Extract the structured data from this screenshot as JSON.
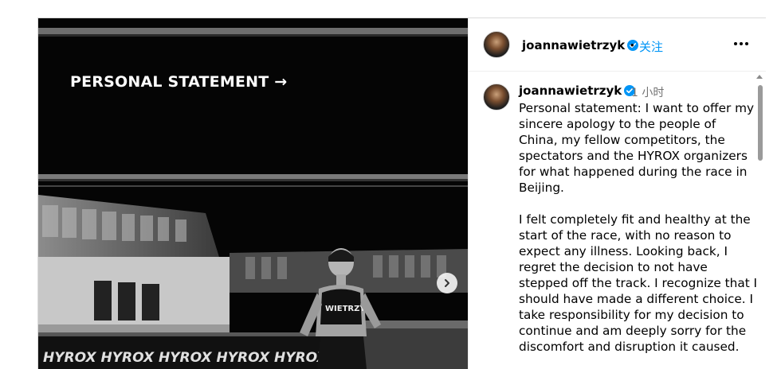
{
  "media": {
    "overlay_text": "PERSONAL STATEMENT →",
    "bib_text": "WIETRZYK",
    "banner_text": "HYROX HYROX HYROX HYROX HYROX HYROX HYROX HYROX"
  },
  "header": {
    "username": "joannawietrzyk",
    "separator": "•",
    "follow_label": "关注",
    "more_icon": "more-options-icon"
  },
  "comment": {
    "username": "joannawietrzyk",
    "time": "1 小时",
    "paragraphs": [
      "Personal statement: I want to offer my sincere apology to the people of China, my fellow competitors, the spectators and the HYROX organizers for what happened during the race in Beijing.",
      "I felt completely fit and healthy at the start of the race, with no reason to expect any illness. Looking back, I regret the decision to not have stepped off the track. I recognize that I should have made a different choice. I take responsibility for my decision to continue and am deeply sorry for the discomfort and disruption it caused."
    ]
  },
  "colors": {
    "link": "#0095f6",
    "verified": "#0095f6",
    "muted": "#737373"
  }
}
